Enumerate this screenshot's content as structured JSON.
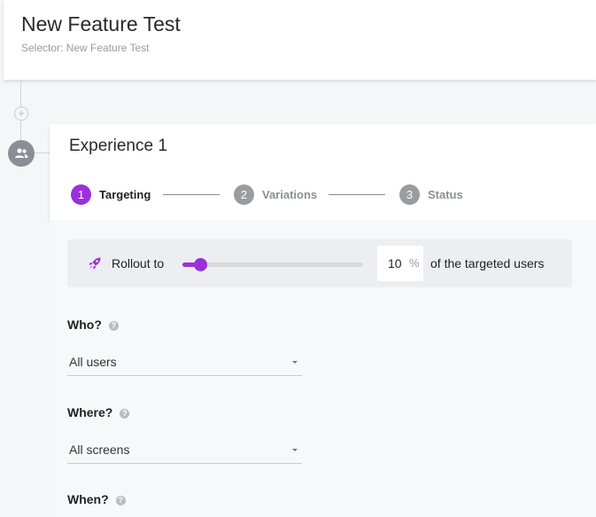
{
  "header": {
    "title": "New Feature Test",
    "subtitle": "Selector: New Feature Test"
  },
  "timeline": {
    "add_icon": "plus-circle-icon",
    "avatar_icon": "users-icon"
  },
  "experience": {
    "title": "Experience 1",
    "steps": [
      {
        "number": "1",
        "label": "Targeting",
        "active": true
      },
      {
        "number": "2",
        "label": "Variations",
        "active": false
      },
      {
        "number": "3",
        "label": "Status",
        "active": false
      }
    ]
  },
  "rollout": {
    "icon": "rocket-icon",
    "label": "Rollout to",
    "percent": "10",
    "percent_sign": "%",
    "suffix": "of the targeted users",
    "slider_fraction": 0.1
  },
  "who": {
    "label": "Who?",
    "help_icon": "help-circle-icon",
    "value": "All users"
  },
  "where": {
    "label": "Where?",
    "help_icon": "help-circle-icon",
    "value": "All screens"
  },
  "when": {
    "label": "When?",
    "help_icon": "help-circle-icon"
  },
  "colors": {
    "accent": "#9b30d9",
    "inactive_step": "#9a9ca0"
  }
}
